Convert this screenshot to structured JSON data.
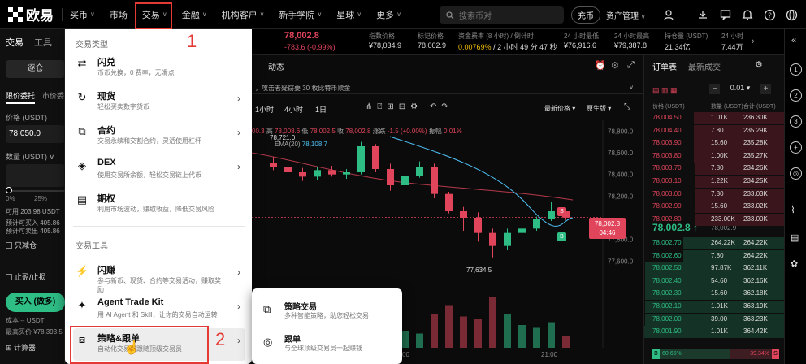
{
  "header": {
    "logo_text": "欧易",
    "nav": [
      {
        "label": "买币",
        "chevron": true
      },
      {
        "label": "市场",
        "chevron": false
      },
      {
        "label": "交易",
        "chevron": true
      },
      {
        "label": "金融",
        "chevron": true
      },
      {
        "label": "机构客户",
        "chevron": true
      },
      {
        "label": "新手学院",
        "chevron": true
      },
      {
        "label": "星球",
        "chevron": true
      },
      {
        "label": "更多",
        "chevron": true
      }
    ],
    "search_placeholder": "搜索币对",
    "deposit_label": "充币",
    "asset_label": "资产管理"
  },
  "annotations": {
    "marker1": "1",
    "marker2": "2"
  },
  "left_panel": {
    "tabs": [
      "交易",
      "工具"
    ],
    "mode": "逐仓",
    "order_tabs": [
      "限价委托",
      "市价委"
    ],
    "price_label": "价格 (USDT)",
    "price_value": "78,050.0",
    "qty_label": "数量 (USDT)",
    "slider_labels": [
      "0%",
      "25%"
    ],
    "available": "可用 203.98 USDT",
    "can_buy": "预计可买入 405.86",
    "can_sell": "预计可卖出 405.86",
    "reduce_only": "只减仓",
    "tpsl": "止盈/止损",
    "buy_button": "买入 (做多)",
    "cost": "成本 -- USDT",
    "max_price": "最高买价 ¥78,393.5",
    "calculator": "计算器"
  },
  "dropdown": {
    "section1": "交易类型",
    "items1": [
      {
        "icon": "exchange-icon",
        "glyph": "⇄",
        "title": "闪兑",
        "desc": "币币兑换，0 费率，无滑点",
        "arrow": false
      },
      {
        "icon": "spot-icon",
        "glyph": "↻",
        "title": "现货",
        "desc": "轻松买卖数字货币",
        "arrow": true
      },
      {
        "icon": "contract-icon",
        "glyph": "⧉",
        "title": "合约",
        "desc": "交易永续和交割合约，灵活使用杠杆",
        "arrow": true
      },
      {
        "icon": "dex-icon",
        "glyph": "◈",
        "title": "DEX",
        "desc": "使用交易所余额，轻松交易链上代币",
        "arrow": true
      },
      {
        "icon": "options-icon",
        "glyph": "▤",
        "title": "期权",
        "desc": "利用市场波动，赚取收益，降低交易风险",
        "arrow": false
      }
    ],
    "section2": "交易工具",
    "items2": [
      {
        "icon": "flash-icon",
        "glyph": "⚡",
        "title": "闪赚",
        "desc": "参与新币、现货、合约等交易活动，赚取奖",
        "desc2": "励",
        "arrow": true
      },
      {
        "icon": "agent-icon",
        "glyph": "✦",
        "title": "Agent Trade Kit",
        "desc": "用 AI Agent 和 Skill，让你的交易自动运转",
        "arrow": true
      },
      {
        "icon": "strategy-icon",
        "glyph": "⧈",
        "title": "策略&跟单",
        "desc": "自动化交易或跟随顶级交易员",
        "arrow": true
      }
    ]
  },
  "submenu": [
    {
      "icon": "strategy-trade-icon",
      "glyph": "⧉",
      "title": "策略交易",
      "desc": "多种智能策略，助您轻松交易"
    },
    {
      "icon": "copy-trade-icon",
      "glyph": "◎",
      "title": "跟单",
      "desc": "与全球顶级交易员一起赚钱"
    }
  ],
  "ticker": {
    "price": "78,002.8",
    "change": "-783.6 (-0.99%)",
    "index_label": "指数价格",
    "index_value": "¥78,034.9",
    "mark_label": "标记价格",
    "mark_value": "78,002.9",
    "funding_label": "资金费率 (8 小时) / 倒计时",
    "funding_value": "0.00769%",
    "funding_countdown": "/ 2 小时 49 分 47 秒",
    "low_label": "24 小时最低",
    "low_value": "¥76,916.6",
    "high_label": "24 小时最高",
    "high_value": "¥79,387.8",
    "oi_label": "持仓量 (USDT)",
    "oi_value": "21.34亿",
    "vol_label": "24 小时",
    "vol_value": "7.44万"
  },
  "chart_header": {
    "tab": "动态",
    "notice": "，攻击者疑窃要 30 枚比特币赎金",
    "intervals": [
      "1小时",
      "4小时",
      "1日"
    ],
    "price_type": "最新价格",
    "style": "原生版",
    "ohlc": {
      "open_tail": "00.3",
      "high": "78,008.6",
      "low": "78,002.5",
      "close": "78,002.8",
      "change": "-1.5 (+0.00%)",
      "amp": "0.01%"
    },
    "ma_val": "78,721.0",
    "ema_label": "EMA(20)",
    "ema_val": "78,108.7",
    "low_marker": "77,634.5"
  },
  "chart_data": {
    "type": "candlestick",
    "yaxis": [
      "78,800.0",
      "78,600.0",
      "78,400.0",
      "78,200.0",
      "78,002.8",
      "77,800.0",
      "77,600.0"
    ],
    "price_tag": "78,002.8",
    "countdown": "04:46",
    "xaxis": [
      "00",
      "21:00"
    ],
    "ylim": [
      77400,
      78900
    ],
    "candles": [
      {
        "o": 78510,
        "h": 78560,
        "l": 78440,
        "c": 78470
      },
      {
        "o": 78470,
        "h": 78510,
        "l": 78380,
        "c": 78420
      },
      {
        "o": 78420,
        "h": 78460,
        "l": 78340,
        "c": 78380
      },
      {
        "o": 78380,
        "h": 78470,
        "l": 78350,
        "c": 78440
      },
      {
        "o": 78440,
        "h": 78480,
        "l": 78380,
        "c": 78400
      },
      {
        "o": 78400,
        "h": 78450,
        "l": 78360,
        "c": 78420
      },
      {
        "o": 78420,
        "h": 78700,
        "l": 78400,
        "c": 78660
      },
      {
        "o": 78660,
        "h": 78680,
        "l": 78420,
        "c": 78450
      },
      {
        "o": 78450,
        "h": 78500,
        "l": 78250,
        "c": 78300
      },
      {
        "o": 78300,
        "h": 78420,
        "l": 78270,
        "c": 78390
      },
      {
        "o": 78390,
        "h": 78520,
        "l": 78370,
        "c": 78470
      },
      {
        "o": 78470,
        "h": 78500,
        "l": 78180,
        "c": 78220
      },
      {
        "o": 78220,
        "h": 78240,
        "l": 78040,
        "c": 78060
      },
      {
        "o": 78060,
        "h": 78100,
        "l": 77880,
        "c": 78000
      },
      {
        "o": 78000,
        "h": 78050,
        "l": 77780,
        "c": 77860
      },
      {
        "o": 77860,
        "h": 77900,
        "l": 77634,
        "c": 77740
      },
      {
        "o": 77740,
        "h": 77900,
        "l": 77700,
        "c": 77860
      },
      {
        "o": 77860,
        "h": 77940,
        "l": 77800,
        "c": 77900
      },
      {
        "o": 77900,
        "h": 78010,
        "l": 77880,
        "c": 77990
      },
      {
        "o": 77990,
        "h": 78150,
        "l": 77970,
        "c": 78060
      },
      {
        "o": 78060,
        "h": 78080,
        "l": 77980,
        "c": 78002
      }
    ],
    "volumes": [
      0.25,
      0.2,
      0.18,
      0.22,
      0.2,
      0.18,
      0.5,
      0.4,
      0.55,
      0.3,
      0.25,
      0.6,
      0.75,
      0.55,
      0.5,
      0.9,
      0.6,
      0.4,
      0.35,
      0.45,
      0.2
    ]
  },
  "orderbook": {
    "tabs": [
      "订单表",
      "最新成交"
    ],
    "precision": "0.01",
    "cols": [
      "价格 (USDT)",
      "数量 (USDT)",
      "合计 (USDT)"
    ],
    "asks": [
      [
        "78,004.50",
        "1.01K",
        "236.30K"
      ],
      [
        "78,004.40",
        "7.80",
        "235.29K"
      ],
      [
        "78,003.90",
        "15.60",
        "235.28K"
      ],
      [
        "78,003.80",
        "1.00K",
        "235.27K"
      ],
      [
        "78,003.70",
        "7.80",
        "234.26K"
      ],
      [
        "78,003.10",
        "1.22K",
        "234.25K"
      ],
      [
        "78,003.00",
        "7.80",
        "233.03K"
      ],
      [
        "78,002.90",
        "15.60",
        "233.02K"
      ],
      [
        "78,002.80",
        "233.00K",
        "233.00K"
      ]
    ],
    "mid_price": "78,002.8",
    "mid_sub": "78,002.9",
    "bids": [
      [
        "78,002.70",
        "264.22K",
        "264.22K"
      ],
      [
        "78,002.60",
        "7.80",
        "264.22K"
      ],
      [
        "78,002.50",
        "97.87K",
        "362.11K"
      ],
      [
        "78,002.40",
        "54.60",
        "362.16K"
      ],
      [
        "78,002.30",
        "15.60",
        "362.18K"
      ],
      [
        "78,002.10",
        "1.01K",
        "363.19K"
      ],
      [
        "78,002.00",
        "39.00",
        "363.23K"
      ],
      [
        "78,001.90",
        "1.01K",
        "364.42K"
      ]
    ],
    "buy_ratio": "60.66%",
    "sell_ratio": "39.34%",
    "buy_tag": "B",
    "sell_tag": "S"
  },
  "sidebar": {
    "badges": [
      "1",
      "2",
      "3"
    ]
  },
  "colors": {
    "red": "#e0455b",
    "green": "#2ebd85",
    "highlight": "#e53935"
  }
}
